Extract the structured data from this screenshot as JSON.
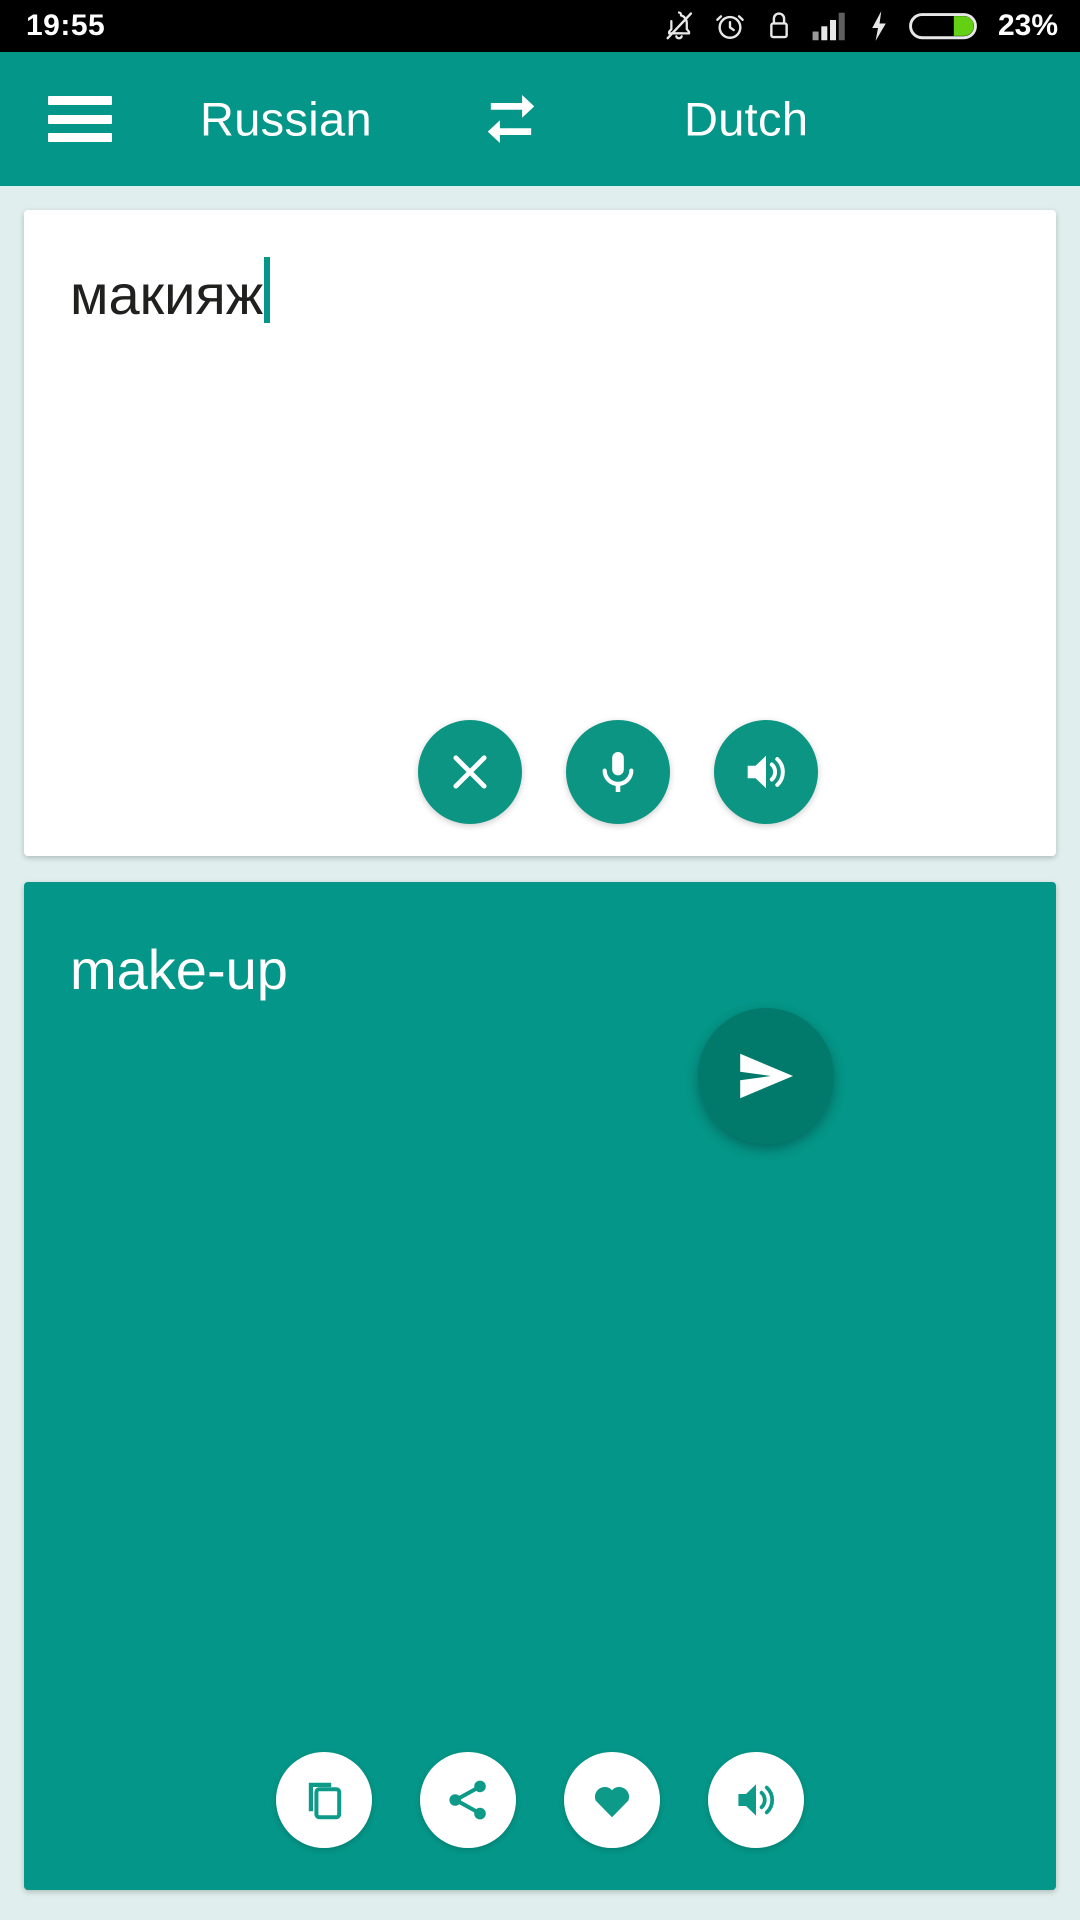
{
  "status_bar": {
    "time": "19:55",
    "battery_percent": "23%",
    "icons": [
      "notifications-off-icon",
      "alarm-icon",
      "usb-lock-icon",
      "signal-bars-icon",
      "charging-bolt-icon",
      "battery-icon"
    ],
    "background": "#000000",
    "text_color": "#ffffff",
    "battery_fill_color": "#63d013"
  },
  "toolbar": {
    "menu_icon": "hamburger-menu-icon",
    "source_language": "Russian",
    "target_language": "Dutch",
    "swap_icon": "swap-languages-icon",
    "background": "#049688",
    "text_color": "#ffffff"
  },
  "input_card": {
    "text": "макияж",
    "caret_color": "#049688",
    "background": "#ffffff",
    "text_color": "#20211f",
    "actions": [
      {
        "name": "clear-button",
        "icon": "close-icon"
      },
      {
        "name": "voice-input-button",
        "icon": "microphone-icon"
      },
      {
        "name": "speak-source-button",
        "icon": "speaker-icon"
      }
    ],
    "button_color": "#0b9582"
  },
  "send_button": {
    "name": "send-button",
    "icon": "send-icon",
    "background": "#027a6b"
  },
  "output_card": {
    "text": "make-up",
    "background": "#049688",
    "text_color": "#ffffff",
    "actions": [
      {
        "name": "copy-button",
        "icon": "copy-icon"
      },
      {
        "name": "share-button",
        "icon": "share-icon"
      },
      {
        "name": "favorite-button",
        "icon": "heart-icon"
      },
      {
        "name": "speak-translation-button",
        "icon": "speaker-icon"
      }
    ],
    "button_color": "#ffffff",
    "button_icon_color": "#0e9a89"
  },
  "page_background": "#e0efed"
}
